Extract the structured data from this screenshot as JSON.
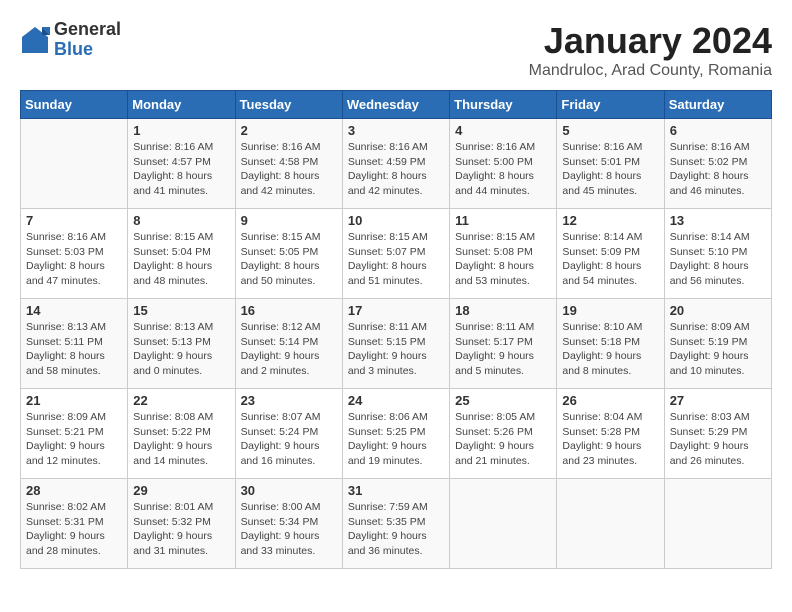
{
  "header": {
    "logo_general": "General",
    "logo_blue": "Blue",
    "month_title": "January 2024",
    "location": "Mandruloc, Arad County, Romania"
  },
  "days_of_week": [
    "Sunday",
    "Monday",
    "Tuesday",
    "Wednesday",
    "Thursday",
    "Friday",
    "Saturday"
  ],
  "weeks": [
    [
      {
        "day": "",
        "info": ""
      },
      {
        "day": "1",
        "info": "Sunrise: 8:16 AM\nSunset: 4:57 PM\nDaylight: 8 hours\nand 41 minutes."
      },
      {
        "day": "2",
        "info": "Sunrise: 8:16 AM\nSunset: 4:58 PM\nDaylight: 8 hours\nand 42 minutes."
      },
      {
        "day": "3",
        "info": "Sunrise: 8:16 AM\nSunset: 4:59 PM\nDaylight: 8 hours\nand 42 minutes."
      },
      {
        "day": "4",
        "info": "Sunrise: 8:16 AM\nSunset: 5:00 PM\nDaylight: 8 hours\nand 44 minutes."
      },
      {
        "day": "5",
        "info": "Sunrise: 8:16 AM\nSunset: 5:01 PM\nDaylight: 8 hours\nand 45 minutes."
      },
      {
        "day": "6",
        "info": "Sunrise: 8:16 AM\nSunset: 5:02 PM\nDaylight: 8 hours\nand 46 minutes."
      }
    ],
    [
      {
        "day": "7",
        "info": "Sunrise: 8:16 AM\nSunset: 5:03 PM\nDaylight: 8 hours\nand 47 minutes."
      },
      {
        "day": "8",
        "info": "Sunrise: 8:15 AM\nSunset: 5:04 PM\nDaylight: 8 hours\nand 48 minutes."
      },
      {
        "day": "9",
        "info": "Sunrise: 8:15 AM\nSunset: 5:05 PM\nDaylight: 8 hours\nand 50 minutes."
      },
      {
        "day": "10",
        "info": "Sunrise: 8:15 AM\nSunset: 5:07 PM\nDaylight: 8 hours\nand 51 minutes."
      },
      {
        "day": "11",
        "info": "Sunrise: 8:15 AM\nSunset: 5:08 PM\nDaylight: 8 hours\nand 53 minutes."
      },
      {
        "day": "12",
        "info": "Sunrise: 8:14 AM\nSunset: 5:09 PM\nDaylight: 8 hours\nand 54 minutes."
      },
      {
        "day": "13",
        "info": "Sunrise: 8:14 AM\nSunset: 5:10 PM\nDaylight: 8 hours\nand 56 minutes."
      }
    ],
    [
      {
        "day": "14",
        "info": "Sunrise: 8:13 AM\nSunset: 5:11 PM\nDaylight: 8 hours\nand 58 minutes."
      },
      {
        "day": "15",
        "info": "Sunrise: 8:13 AM\nSunset: 5:13 PM\nDaylight: 9 hours\nand 0 minutes."
      },
      {
        "day": "16",
        "info": "Sunrise: 8:12 AM\nSunset: 5:14 PM\nDaylight: 9 hours\nand 2 minutes."
      },
      {
        "day": "17",
        "info": "Sunrise: 8:11 AM\nSunset: 5:15 PM\nDaylight: 9 hours\nand 3 minutes."
      },
      {
        "day": "18",
        "info": "Sunrise: 8:11 AM\nSunset: 5:17 PM\nDaylight: 9 hours\nand 5 minutes."
      },
      {
        "day": "19",
        "info": "Sunrise: 8:10 AM\nSunset: 5:18 PM\nDaylight: 9 hours\nand 8 minutes."
      },
      {
        "day": "20",
        "info": "Sunrise: 8:09 AM\nSunset: 5:19 PM\nDaylight: 9 hours\nand 10 minutes."
      }
    ],
    [
      {
        "day": "21",
        "info": "Sunrise: 8:09 AM\nSunset: 5:21 PM\nDaylight: 9 hours\nand 12 minutes."
      },
      {
        "day": "22",
        "info": "Sunrise: 8:08 AM\nSunset: 5:22 PM\nDaylight: 9 hours\nand 14 minutes."
      },
      {
        "day": "23",
        "info": "Sunrise: 8:07 AM\nSunset: 5:24 PM\nDaylight: 9 hours\nand 16 minutes."
      },
      {
        "day": "24",
        "info": "Sunrise: 8:06 AM\nSunset: 5:25 PM\nDaylight: 9 hours\nand 19 minutes."
      },
      {
        "day": "25",
        "info": "Sunrise: 8:05 AM\nSunset: 5:26 PM\nDaylight: 9 hours\nand 21 minutes."
      },
      {
        "day": "26",
        "info": "Sunrise: 8:04 AM\nSunset: 5:28 PM\nDaylight: 9 hours\nand 23 minutes."
      },
      {
        "day": "27",
        "info": "Sunrise: 8:03 AM\nSunset: 5:29 PM\nDaylight: 9 hours\nand 26 minutes."
      }
    ],
    [
      {
        "day": "28",
        "info": "Sunrise: 8:02 AM\nSunset: 5:31 PM\nDaylight: 9 hours\nand 28 minutes."
      },
      {
        "day": "29",
        "info": "Sunrise: 8:01 AM\nSunset: 5:32 PM\nDaylight: 9 hours\nand 31 minutes."
      },
      {
        "day": "30",
        "info": "Sunrise: 8:00 AM\nSunset: 5:34 PM\nDaylight: 9 hours\nand 33 minutes."
      },
      {
        "day": "31",
        "info": "Sunrise: 7:59 AM\nSunset: 5:35 PM\nDaylight: 9 hours\nand 36 minutes."
      },
      {
        "day": "",
        "info": ""
      },
      {
        "day": "",
        "info": ""
      },
      {
        "day": "",
        "info": ""
      }
    ]
  ]
}
